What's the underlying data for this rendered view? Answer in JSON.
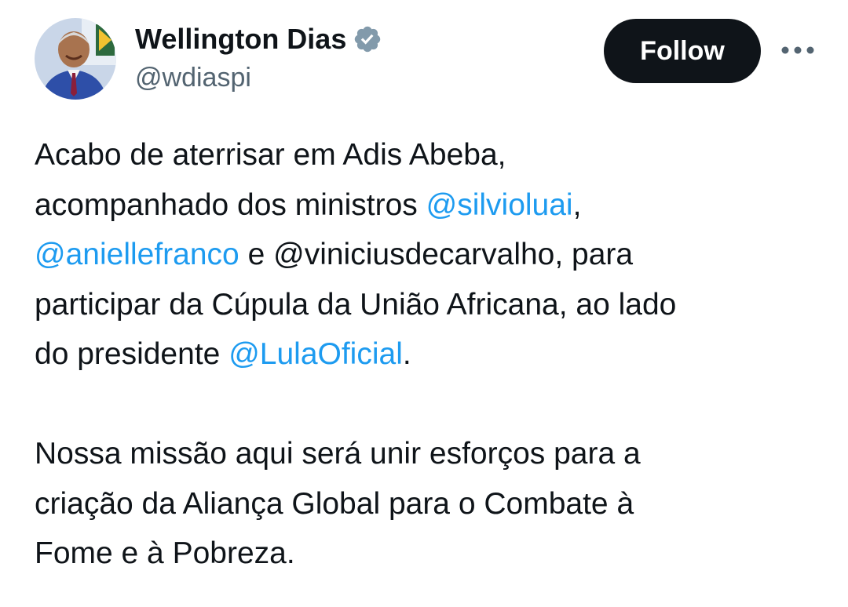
{
  "header": {
    "display_name": "Wellington Dias",
    "handle": "@wdiaspi",
    "follow_label": "Follow",
    "more_label": "•••",
    "verified_icon": "verified-badge-icon",
    "verified_color": "#829aab"
  },
  "tweet": {
    "p1": {
      "l1": "Acabo de aterrisar em Adis Abeba,",
      "l2_pre": "acompanhado dos ministros ",
      "l2_mention": "@silvioluai",
      "l2_post": ",",
      "l3_mention": "@aniellefranco",
      "l3_post": " e @viniciusdecarvalho, para",
      "l4": "participar da Cúpula da União Africana, ao lado",
      "l5_pre": "do presidente ",
      "l5_mention": "@LulaOficial",
      "l5_post": "."
    },
    "p2": {
      "l1": "Nossa missão aqui será unir esforços para a",
      "l2": "criação da Aliança Global para o Combate à",
      "l3": "Fome e à Pobreza."
    }
  },
  "colors": {
    "text": "#0f1419",
    "secondary": "#536471",
    "link": "#1d9bf0",
    "button_bg": "#0f1419",
    "button_text": "#ffffff"
  }
}
